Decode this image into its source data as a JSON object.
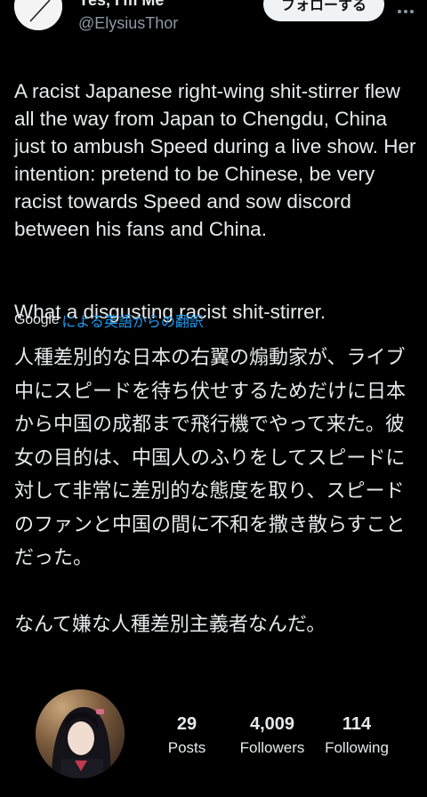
{
  "header": {
    "display_name": "Yes, I'm Me",
    "handle": "@ElysiusThor",
    "follow_label": "フォローする"
  },
  "tweet": {
    "text_p1": "A racist Japanese right-wing shit-stirrer flew all the way from Japan to Chengdu, China just to ambush Speed during a live show. Her intention: pretend to be Chinese, be very racist towards Speed and sow discord between his fans and China.",
    "text_p2": "What a disgusting racist shit-stirrer.",
    "translate_brand": "Google",
    "translate_label": "による英語からの翻訳",
    "translated_p1": "人種差別的な日本の右翼の煽動家が、ライブ中にスピードを待ち伏せするためだけに日本から中国の成都まで飛行機でやって来た。彼女の目的は、中国人のふりをしてスピードに対して非常に差別的な態度を取り、スピードのファンと中国の間に不和を撒き散らすことだった。",
    "translated_p2": "なんて嫌な人種差別主義者なんだ。"
  },
  "profile": {
    "posts_count": "29",
    "posts_label": "Posts",
    "followers_count": "4,009",
    "followers_label": "Followers",
    "following_count": "114",
    "following_label": "Following"
  },
  "colors": {
    "background": "#000000",
    "text": "#e7e9ea",
    "muted": "#8b98a5",
    "link": "#1d9bf0"
  },
  "icons": [
    "avatar",
    "more-icon"
  ]
}
